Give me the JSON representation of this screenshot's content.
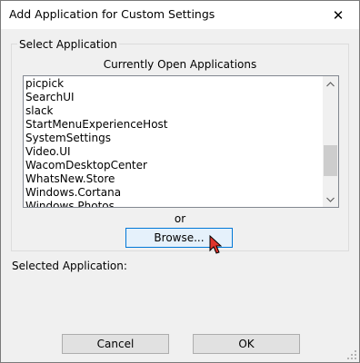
{
  "window": {
    "title": "Add Application for Custom Settings",
    "close_glyph": "✕"
  },
  "group": {
    "legend": "Select Application"
  },
  "list": {
    "header": "Currently Open Applications",
    "items": [
      "picpick",
      "SearchUI",
      "slack",
      "StartMenuExperienceHost",
      "SystemSettings",
      "Video.UI",
      "WacomDesktopCenter",
      "WhatsNew.Store",
      "Windows.Cortana",
      "Windows.Photos"
    ],
    "scroll_position": 0.78
  },
  "or_text": "or",
  "browse_label": "Browse...",
  "selected_label": "Selected Application:",
  "buttons": {
    "cancel": "Cancel",
    "ok": "OK"
  },
  "colors": {
    "accent": "#0078d7",
    "cursor": "#e0342c"
  }
}
